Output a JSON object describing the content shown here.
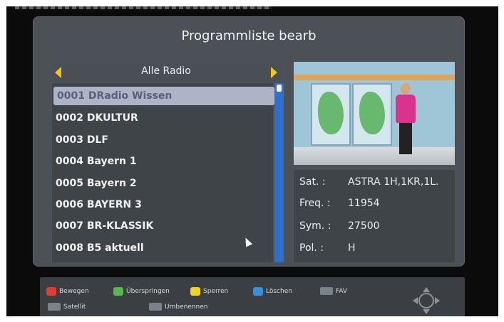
{
  "title": "Programmliste bearb",
  "list_header": "Alle Radio",
  "channels": [
    "0001 DRadio Wissen",
    "0002 DKULTUR",
    "0003 DLF",
    "0004 Bayern 1",
    "0005 Bayern 2",
    "0006 BAYERN 3",
    "0007 BR-KLASSIK",
    "0008 B5 aktuell"
  ],
  "selected_index": 0,
  "info": {
    "sat_label": "Sat. :",
    "sat_value": "ASTRA 1H,1KR,1L.",
    "freq_label": "Freq. :",
    "freq_value": "11954",
    "sym_label": "Sym. :",
    "sym_value": "27500",
    "pol_label": "Pol. :",
    "pol_value": "H"
  },
  "legend": {
    "red": "Bewegen",
    "green": "Überspringen",
    "yellow": "Sperren",
    "blue": "Löschen",
    "fav": "FAV",
    "satellit": "Satellit",
    "umbenennen": "Umbenennen"
  },
  "colors": {
    "red_key": "#e23b32",
    "green_key": "#57b84b",
    "yellow_key": "#f1d21c",
    "blue_key": "#3a8ee0",
    "scrollbar": "#2f6fd0",
    "selection": "#aeb4c8"
  }
}
